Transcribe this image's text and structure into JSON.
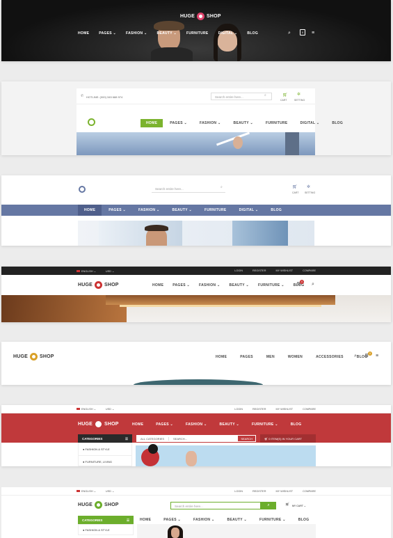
{
  "p1": {
    "logo_left": "HUGE",
    "logo_right": "SHOP",
    "nav": [
      "HOME",
      "PAGES ⌄",
      "FASHION ⌄",
      "BEAUTY ⌄",
      "FURNITURE",
      "DIGITAL ⌄",
      "BLOG"
    ],
    "cart_count": "0"
  },
  "p2": {
    "hotline": "HOTLINE: (000) 345 688 974",
    "search_placeholder": "Search entire here...",
    "cart": "CART",
    "setting": "SETTING",
    "nav": [
      "HOME",
      "PAGES ⌄",
      "FASHION ⌄",
      "BEAUTY ⌄",
      "FURNITURE",
      "DIGITAL ⌄",
      "BLOG"
    ]
  },
  "p3": {
    "search_placeholder": "Search entire here...",
    "cart": "CART",
    "setting": "SETTING",
    "nav": [
      "HOME",
      "PAGES ⌄",
      "FASHION ⌄",
      "BEAUTY ⌄",
      "FURNITURE",
      "DIGITAL ⌄",
      "BLOG"
    ]
  },
  "p4": {
    "lang": "ENGLISH ⌄",
    "currency": "USD ⌄",
    "login": "LOGIN",
    "register": "REGISTER",
    "wishlist": "MY WISHLIST",
    "compare": "COMPARE",
    "logo_left": "HUGE",
    "logo_right": "SHOP",
    "nav": [
      "HOME",
      "PAGES ⌄",
      "FASHION ⌄",
      "BEAUTY ⌄",
      "FURNITURE ⌄",
      "BLOG"
    ],
    "cart_count": "0"
  },
  "p5": {
    "logo_left": "HUGE",
    "logo_right": "SHOP",
    "nav": [
      "HOME",
      "PAGES",
      "MEN",
      "WOMEN",
      "ACCESSORIES",
      "BLOG"
    ],
    "cart_count": "0"
  },
  "p6": {
    "lang": "ENGLISH ⌄",
    "currency": "USD ⌄",
    "login": "LOGIN",
    "register": "REGISTER",
    "wishlist": "MY WISHLIST",
    "compare": "COMPARE",
    "logo_left": "HUGE",
    "logo_right": "SHOP",
    "nav": [
      "HOME",
      "PAGES ⌄",
      "FASHION ⌄",
      "BEAUTY ⌄",
      "FURNITURE ⌄",
      "BLOG"
    ],
    "categories": "CATEGORIES",
    "all_categories": "ALL CATEGORIES",
    "search": "SEARCH...",
    "search_btn": "SEARCH",
    "cart_text": "0 ITEM(S) IN YOUR CART",
    "cat_items": [
      "FASHION & STYLE",
      "FURNITURE, LIVING"
    ]
  },
  "p7": {
    "lang": "ENGLISH ⌄",
    "currency": "USD ⌄",
    "login": "LOGIN",
    "register": "REGISTER",
    "wishlist": "MY WISHLIST",
    "compare": "COMPARE",
    "logo_left": "HUGE",
    "logo_right": "SHOP",
    "search_placeholder": "Search entire here...",
    "mycart": "MY CART ⌄",
    "nav": [
      "HOME",
      "PAGES ⌄",
      "FASHION ⌄",
      "BEAUTY ⌄",
      "FURNITURE ⌄",
      "BLOG"
    ],
    "categories": "CATEGORIES",
    "cat_items": [
      "FASHION & STYLE"
    ]
  }
}
